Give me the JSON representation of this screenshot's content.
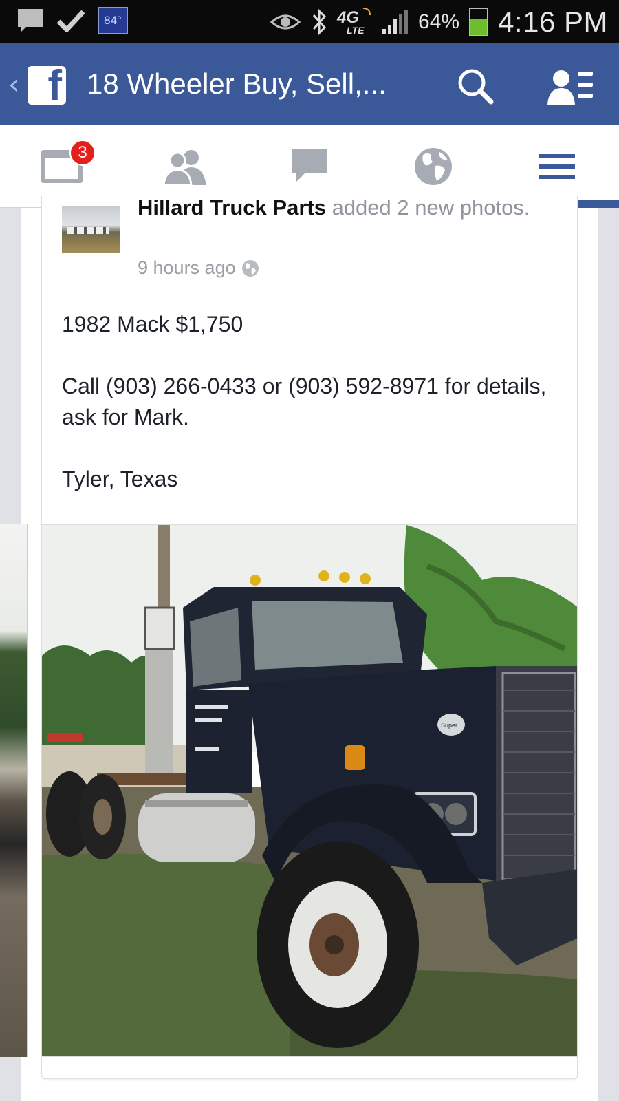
{
  "status_bar": {
    "temperature": "84°",
    "network": "4G",
    "network_sub": "LTE",
    "battery_percent_label": "64%",
    "battery_level": 0.64,
    "time": "4:16 PM"
  },
  "header": {
    "group_title": "18 Wheeler Buy, Sell,...",
    "icons": [
      "back-chevron-icon",
      "facebook-logo-icon",
      "search-icon",
      "friends-list-icon"
    ]
  },
  "nav": {
    "tabs": [
      {
        "name": "news-feed",
        "icon": "news-feed-icon",
        "badge": "3"
      },
      {
        "name": "friend-requests",
        "icon": "friends-icon"
      },
      {
        "name": "messages",
        "icon": "chat-bubble-icon"
      },
      {
        "name": "notifications",
        "icon": "globe-icon"
      },
      {
        "name": "more",
        "icon": "hamburger-menu-icon",
        "active": true
      }
    ],
    "accent": "#3b5998",
    "badge_color": "#e3201b"
  },
  "post": {
    "author": "Hillard Truck Parts",
    "action": "added 2 new photos.",
    "time": "9 hours ago",
    "privacy_icon": "globe-icon",
    "body": [
      "1982 Mack $1,750",
      "Call (903) 266-0433 or (903) 592-8971 for details, ask for Mark.",
      "Tyler, Texas"
    ],
    "truck_badge": "Super"
  }
}
